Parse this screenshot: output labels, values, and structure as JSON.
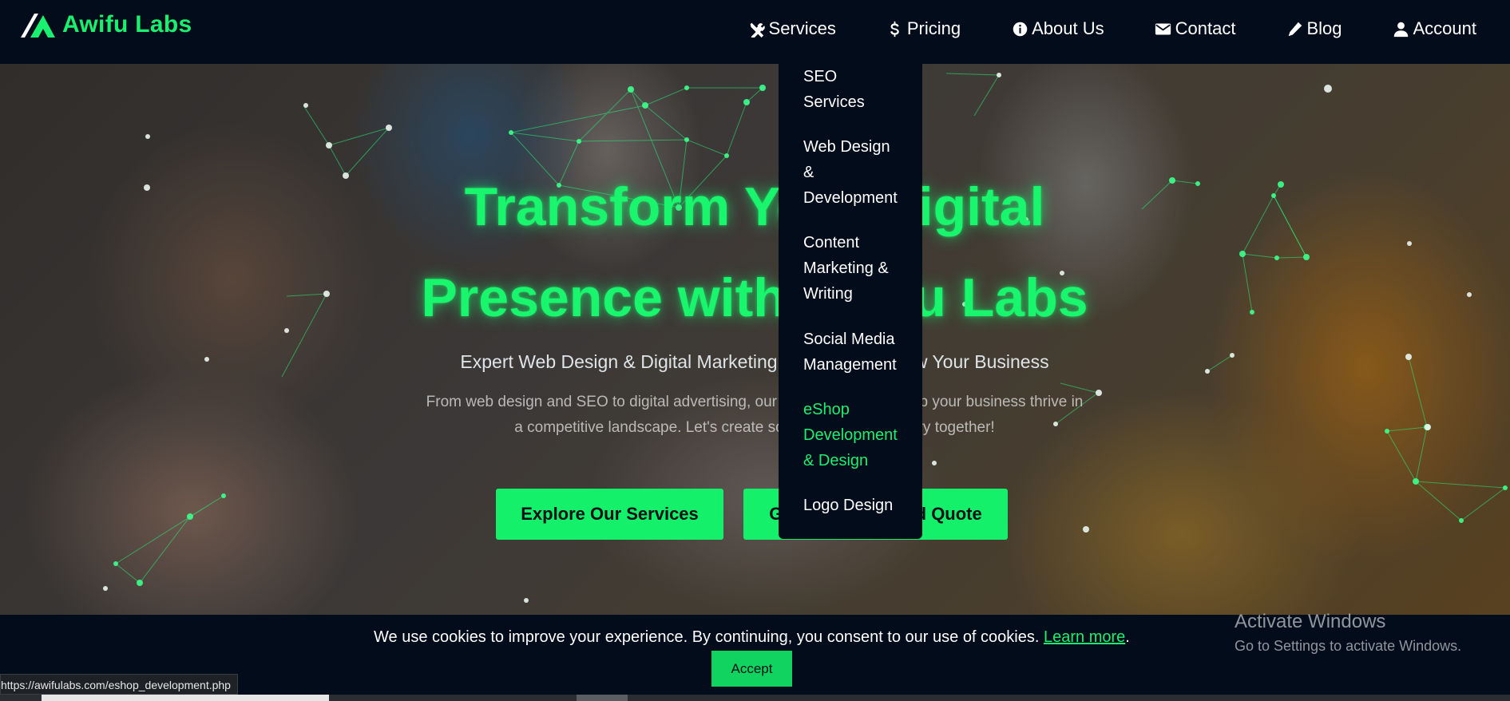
{
  "brand": {
    "name": "Awifu Labs"
  },
  "nav": {
    "items": [
      {
        "label": "Services",
        "icon": "tools-icon"
      },
      {
        "label": "Pricing",
        "icon": "dollar-icon"
      },
      {
        "label": "About Us",
        "icon": "info-icon"
      },
      {
        "label": "Contact",
        "icon": "envelope-icon"
      },
      {
        "label": "Blog",
        "icon": "pencil-icon"
      },
      {
        "label": "Account",
        "icon": "user-icon"
      }
    ]
  },
  "services_menu": {
    "items": [
      {
        "label_lines": [
          "SEO",
          "Services"
        ],
        "active": false
      },
      {
        "label_lines": [
          "Web Design",
          "&",
          "Development"
        ],
        "active": false
      },
      {
        "label_lines": [
          "Content",
          "Marketing &",
          "Writing"
        ],
        "active": false
      },
      {
        "label_lines": [
          "Social Media",
          "Management"
        ],
        "active": false
      },
      {
        "label_lines": [
          "eShop",
          "Development",
          "& Design"
        ],
        "active": true
      },
      {
        "label_lines": [
          "Logo Design"
        ],
        "active": false
      }
    ]
  },
  "hero": {
    "title_line1": "Transform Your Digital",
    "title_line2": "Presence with Awifu Labs",
    "subtitle": "Expert Web Design & Digital Marketing Solutions to Grow Your Business",
    "description_line1": "From web design and SEO to digital advertising, our tailored solutions help your business thrive in",
    "description_line2": "a competitive landscape. Let's create something extraordinary together!",
    "explore_button": "Explore Our Services",
    "quote_button": "Get a Personalized Quote"
  },
  "cookie": {
    "message": "We use cookies to improve your experience. By continuing, you consent to our use of cookies.",
    "link_text": "Learn more",
    "after_link": ".",
    "accept_label": "Accept"
  },
  "windows_watermark": {
    "title": "Activate Windows",
    "subtitle": "Go to Settings to activate Windows."
  },
  "status_bar": {
    "url": "https://awifulabs.com/eshop_development.php"
  },
  "colors": {
    "accent": "#19f06f",
    "navbar": "#030c1b"
  }
}
